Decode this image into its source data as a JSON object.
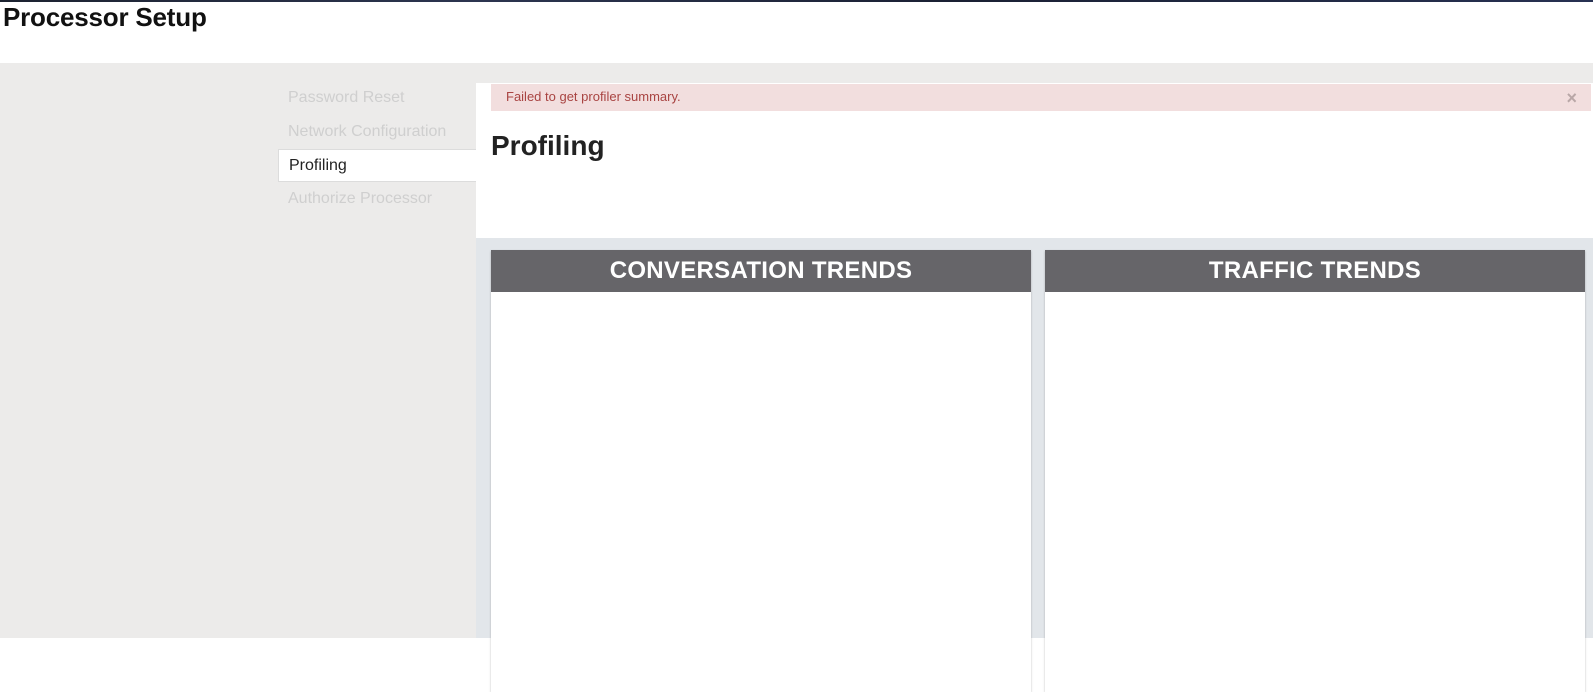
{
  "header": {
    "title": "Processor Setup"
  },
  "nav": {
    "items": [
      {
        "label": "Password Reset",
        "active": false
      },
      {
        "label": "Network Configuration",
        "active": false
      },
      {
        "label": "Profiling",
        "active": true
      },
      {
        "label": "Authorize Processor",
        "active": false
      }
    ]
  },
  "alert": {
    "message": "Failed to get profiler summary.",
    "close_glyph": "×"
  },
  "main": {
    "title": "Profiling",
    "panels": [
      {
        "title": "CONVERSATION TRENDS"
      },
      {
        "title": "TRAFFIC TRENDS"
      }
    ]
  },
  "colors": {
    "alert_bg": "#f2dede",
    "alert_text": "#a94442",
    "panel_header_bg": "#666569",
    "sidebar_bg": "#ecebea"
  }
}
